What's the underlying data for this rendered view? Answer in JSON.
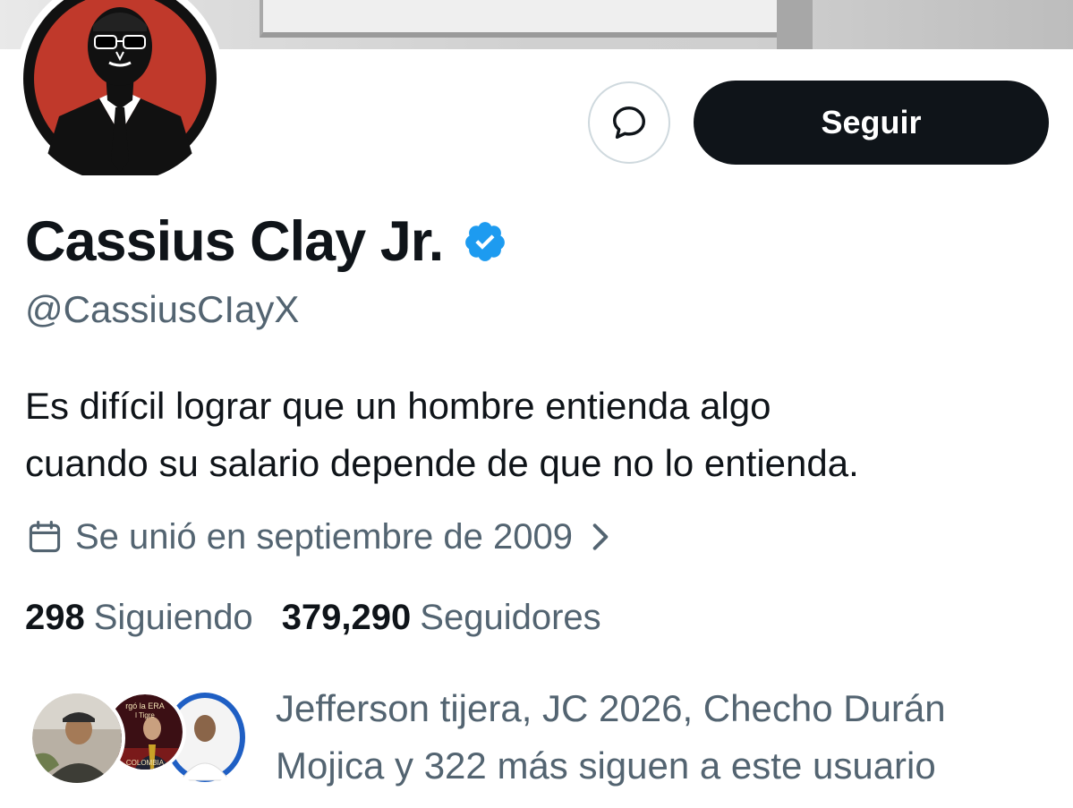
{
  "profile": {
    "name": "Cassius Clay Jr.",
    "handle": "@CassiusCIayX",
    "verified_icon": "verified-badge-icon",
    "bio_line1": "Es difícil lograr que un hombre entienda algo",
    "bio_line2": "cuando su salario depende de que no lo entienda.",
    "joined": "Se unió en septiembre de 2009"
  },
  "actions": {
    "message_icon": "message-bubble-icon",
    "follow_label": "Seguir"
  },
  "stats": {
    "following_count": "298",
    "following_label": "Siguiendo",
    "followers_count": "379,290",
    "followers_label": "Seguidores"
  },
  "followed_by": {
    "text_line1": "Jefferson tijera, JC 2026, Checho Durán",
    "text_line2": "Mojica y 322 más siguen a este usuario",
    "avatar2_caption_top": "rgó la ERA",
    "avatar2_caption_mid": "l Tigre",
    "avatar2_caption_bottom": "COLOMBIA"
  },
  "colors": {
    "primary_text": "#0f1419",
    "secondary_text": "#536471",
    "verified_blue": "#1d9bf0",
    "avatar_red": "#c0392b"
  }
}
